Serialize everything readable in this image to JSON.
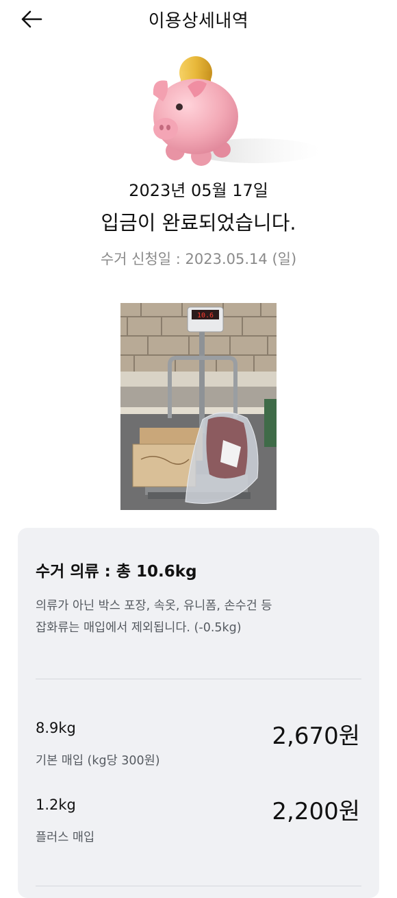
{
  "header": {
    "title": "이용상세내역",
    "back_icon": "arrow-left-icon"
  },
  "summary": {
    "date": "2023년 05월 17일",
    "status": "입금이 완료되었습니다.",
    "request_label": "수거 신청일 : ",
    "request_date": "2023.05.14 (일)",
    "illustration": "piggy-bank-icon"
  },
  "card": {
    "title": "수거 의류 : 총 10.6kg",
    "note_line1": "의류가 아닌 박스 포장, 속옷, 유니폼, 손수건 등",
    "note_line2": "잡화류는 매입에서 제외됩니다. (-0.5kg)",
    "items": [
      {
        "weight": "8.9kg",
        "label": "기본 매입 (kg당 300원)",
        "amount": "2,670원"
      },
      {
        "weight": "1.2kg",
        "label": "플러스 매입",
        "amount": "2,200원"
      }
    ]
  },
  "colors": {
    "piggy_pink": "#f3a9b6",
    "coin_gold": "#e8b83a",
    "card_bg": "#f0f1f4",
    "muted_text": "#8a8a8a"
  }
}
